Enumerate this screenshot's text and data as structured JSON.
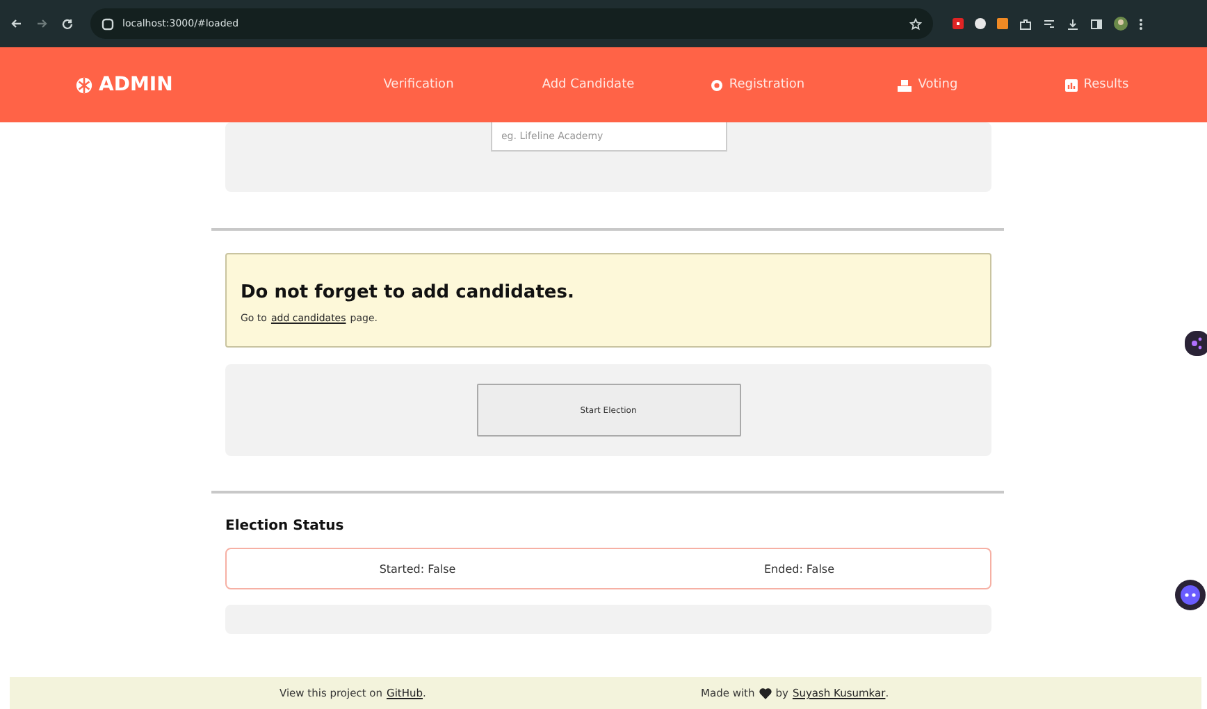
{
  "browser": {
    "url": "localhost:3000/#loaded"
  },
  "navbar": {
    "brand": "ADMIN",
    "items": [
      {
        "label": "Verification"
      },
      {
        "label": "Add Candidate"
      },
      {
        "label": "Registration"
      },
      {
        "label": "Voting"
      },
      {
        "label": "Results"
      }
    ]
  },
  "election_form": {
    "placeholder": "eg. Lifeline Academy"
  },
  "alert": {
    "title": "Do not forget to add candidates.",
    "prefix": "Go to",
    "link": "add candidates",
    "suffix": "page."
  },
  "start_button": "Start Election",
  "election_status": {
    "heading": "Election Status",
    "items": [
      "Started: False",
      "Ended: False"
    ]
  },
  "footer": {
    "left_text": "View this project on",
    "left_link": "GitHub",
    "left_end": ".",
    "right_text": "Made with",
    "right_by": "by",
    "right_link": "Suyash Kusumkar",
    "right_end": "."
  }
}
